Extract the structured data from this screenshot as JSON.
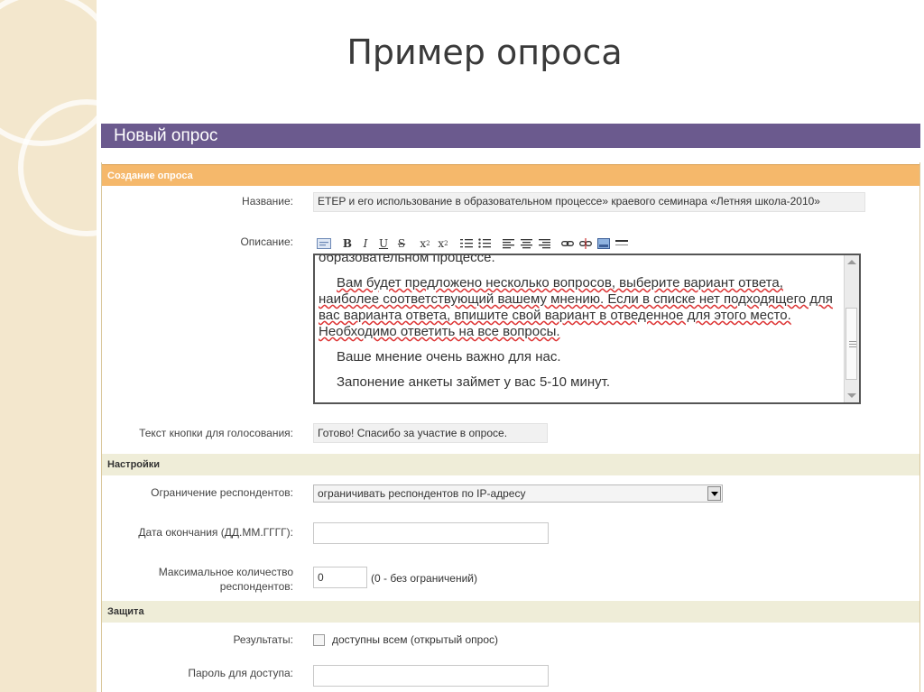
{
  "slide": {
    "title": "Пример опроса"
  },
  "form": {
    "header": "Новый опрос",
    "sections": {
      "create": "Создание опроса",
      "settings": "Настройки",
      "protection": "Защита"
    },
    "fields": {
      "name": {
        "label": "Название:",
        "value": "ETEP и его использование в образовательном процессе» краевого семинара «Летняя школа-2010»"
      },
      "description": {
        "label": "Описание:",
        "toolbar": [
          "source-icon",
          "bold-icon",
          "italic-icon",
          "underline-icon",
          "strike-icon",
          "subscript-icon",
          "superscript-icon",
          "ordered-list-icon",
          "unordered-list-icon",
          "align-left-icon",
          "align-center-icon",
          "align-right-icon",
          "link-icon",
          "unlink-icon",
          "image-icon",
          "horizontal-rule-icon"
        ],
        "toolbar_labels": {
          "bold": "B",
          "italic": "I",
          "underline": "U",
          "strike": "S",
          "subscript": "x",
          "superscript": "x"
        },
        "text": {
          "line0": "образовательном процессе.",
          "para1": "Вам будет предложено несколько вопросов, выберите вариант ответа, наиболее соответствующий вашему мнению. Если в списке нет подходящего для вас варианта ответа, впишите свой вариант в отведенное для этого место. Необходимо ответить на все вопросы.",
          "para2": "Ваше мнение очень важно для нас.",
          "para3": "Запонение анкеты займет у вас 5-10 минут."
        }
      },
      "vote_button": {
        "label": "Текст кнопки для голосования:",
        "value": "Готово! Спасибо за участие в опросе."
      },
      "restriction": {
        "label": "Ограничение респондентов:",
        "value": "ограничивать респондентов по IP-адресу"
      },
      "end_date": {
        "label": "Дата окончания (ДД.ММ.ГГГГ):",
        "value": ""
      },
      "max_respondents": {
        "label_line1": "Максимальное количество",
        "label_line2": "респондентов:",
        "value": "0",
        "hint": "(0 - без ограничений)"
      },
      "results": {
        "label": "Результаты:",
        "checkbox_label": "доступны всем (открытый опрос)",
        "checked": false
      },
      "password": {
        "label": "Пароль для доступа:",
        "value": ""
      }
    }
  }
}
